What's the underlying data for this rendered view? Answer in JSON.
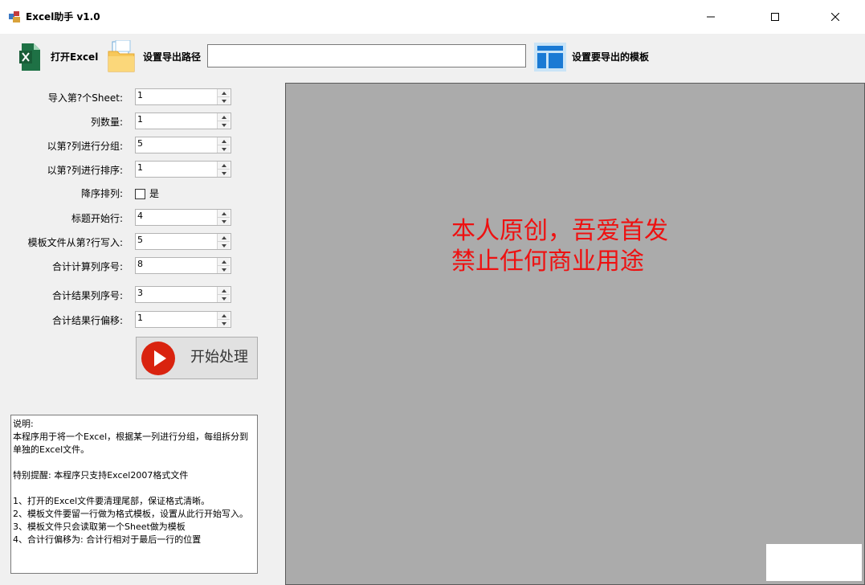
{
  "window": {
    "title": "Excel助手 v1.0",
    "controls": [
      "minimize-icon",
      "maximize-icon",
      "close-icon"
    ]
  },
  "toolbar": {
    "open_excel_label": "打开Excel",
    "set_export_path_label": "设置导出路径",
    "export_path_value": "",
    "set_template_label": "设置要导出的模板"
  },
  "form": {
    "sheet_index": {
      "label": "导入第?个Sheet:",
      "value": "1"
    },
    "column_count": {
      "label": "列数量:",
      "value": "1"
    },
    "group_column": {
      "label": "以第?列进行分组:",
      "value": "5"
    },
    "sort_column": {
      "label": "以第?列进行排序:",
      "value": "1"
    },
    "descending": {
      "label": "降序排列:",
      "checkbox_label": "是",
      "checked": false
    },
    "header_start_row": {
      "label": "标题开始行:",
      "value": "4"
    },
    "template_write_row": {
      "label": "模板文件从第?行写入:",
      "value": "5"
    },
    "sum_column": {
      "label": "合计计算列序号:",
      "value": "8"
    },
    "sum_result_column": {
      "label": "合计结果列序号:",
      "value": "3"
    },
    "sum_result_offset": {
      "label": "合计结果行偏移:",
      "value": "1"
    }
  },
  "start_button": {
    "label": "开始处理"
  },
  "notes": "说明:\n本程序用于将一个Excel，根据某一列进行分组，每组拆分到单独的Excel文件。\n\n特别提醒: 本程序只支持Excel2007格式文件\n\n1、打开的Excel文件要清理尾部，保证格式清晰。\n2、模板文件要留一行做为格式模板，设置从此行开始写入。\n3、模板文件只会读取第一个Sheet做为模板\n4、合计行偏移为: 合计行相对于最后一行的位置",
  "preview": {
    "line1": "本人原创，吾爱首发",
    "line2": "禁止任何商业用途",
    "text_color": "#ee1111",
    "background": "#ababab"
  }
}
